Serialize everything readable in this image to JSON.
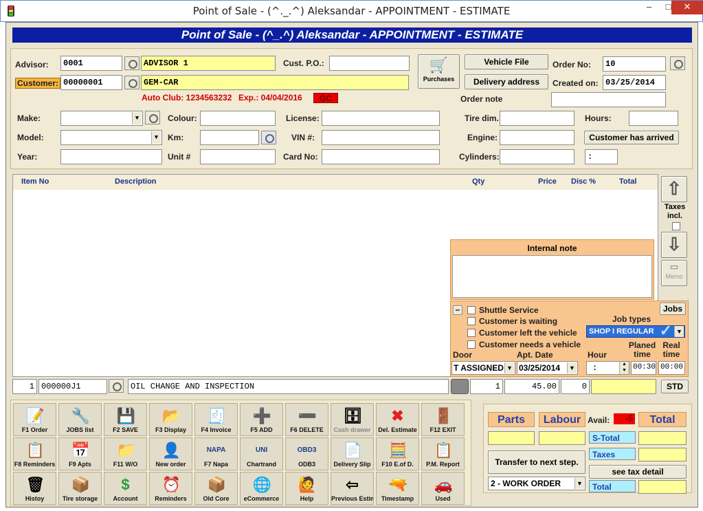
{
  "window": {
    "title": "Point of Sale - (^._.^) Aleksandar - APPOINTMENT - ESTIMATE",
    "minimize": "–",
    "maximize": "□",
    "close": "✕"
  },
  "banner": "Point of Sale - (^_.^) Aleksandar - APPOINTMENT - ESTIMATE",
  "header": {
    "advisor_label": "Advisor:",
    "advisor_code": "0001",
    "advisor_name": "ADVISOR 1",
    "customer_label": "Customer:",
    "customer_code": "00000001",
    "customer_name": "GEM-CAR",
    "auto_club": "Auto Club: 1234563232",
    "expiry": "Exp.: 04/04/2016",
    "gc_badge": "GC",
    "cust_po_label": "Cust. P.O.:",
    "cust_po": "",
    "purchases_label": "Purchases",
    "vehicle_file": "Vehicle File",
    "delivery_address": "Delivery address",
    "order_no_label": "Order No:",
    "order_no": "10",
    "created_label": "Created on:",
    "created_on": "03/25/2014",
    "order_note_label": "Order note",
    "order_note": ""
  },
  "vehicle": {
    "make_label": "Make:",
    "model_label": "Model:",
    "year_label": "Year:",
    "colour_label": "Colour:",
    "km_label": "Km:",
    "unit_label": "Unit #",
    "license_label": "License:",
    "vin_label": "VIN #:",
    "card_label": "Card No:",
    "tire_label": "Tire dim.",
    "engine_label": "Engine:",
    "cyl_label": "Cylinders:",
    "hours_label": "Hours:",
    "arrived_button": "Customer has arrived",
    "time_value": ":"
  },
  "grid": {
    "columns": [
      "Item No",
      "Description",
      "Qty",
      "Price",
      "Disc %",
      "Total"
    ],
    "taxes_incl": "Taxes incl.",
    "memo": "Memo"
  },
  "internal_note": {
    "title": "Internal note",
    "text": ""
  },
  "options": {
    "collapse": "–",
    "shuttle": "Shuttle Service",
    "waiting": "Customer is waiting",
    "left_vehicle": "Customer left the vehicle",
    "needs_vehicle": "Customer needs a vehicle",
    "jobs_button": "Jobs",
    "job_types_label": "Job types",
    "job_type_value": "SHOP I REGULAR",
    "door_label": "Door",
    "door_value": "T ASSIGNED",
    "apt_date_label": "Apt. Date",
    "apt_date_value": "03/25/2014",
    "hour_label": "Hour",
    "hour_value": ":",
    "planed_label": "Planed time",
    "planed_value": "00:30",
    "real_label": "Real time",
    "real_value": "00:00"
  },
  "entry_row": {
    "line": "1",
    "item": "000000J1",
    "description": "OIL CHANGE AND INSPECTION",
    "qty": "1",
    "price": "45.00",
    "disc": "0",
    "std": "STD"
  },
  "toolbar": [
    {
      "label": "F1 Order",
      "icon": "📝",
      "name": "f1-order-button"
    },
    {
      "label": "JOBS list",
      "icon": "🔧",
      "name": "jobs-list-button"
    },
    {
      "label": "F2 SAVE",
      "icon": "💾",
      "name": "f2-save-button"
    },
    {
      "label": "F3 Display",
      "icon": "📂",
      "name": "f3-display-button"
    },
    {
      "label": "F4 Invoice",
      "icon": "🧾",
      "name": "f4-invoice-button"
    },
    {
      "label": "F5 ADD",
      "icon": "➕",
      "name": "f5-add-button"
    },
    {
      "label": "F6 DELETE",
      "icon": "➖",
      "name": "f6-delete-button"
    },
    {
      "label": "Cash drawer",
      "icon": "🗄",
      "name": "cash-drawer-button",
      "dim": true
    },
    {
      "label": "Del. Estimate",
      "icon": "✖",
      "name": "del-estimate-button"
    },
    {
      "label": "F12 EXIT",
      "icon": "🚪",
      "name": "f12-exit-button"
    },
    {
      "label": "F8 Reminders",
      "icon": "📋",
      "name": "f8-reminders-button"
    },
    {
      "label": "F9 Apts",
      "icon": "📅",
      "name": "f9-apts-button"
    },
    {
      "label": "F11 W/O",
      "icon": "📁",
      "name": "f11-wo-button"
    },
    {
      "label": "New order",
      "icon": "👤",
      "name": "new-order-button"
    },
    {
      "label": "F7 Napa",
      "icon": "NAPA",
      "name": "f7-napa-button"
    },
    {
      "label": "Chartrand",
      "icon": "UNI",
      "name": "chartrand-button"
    },
    {
      "label": "ODB3",
      "icon": "OBD3",
      "name": "odb3-button"
    },
    {
      "label": "Delivery Slip",
      "icon": "📄",
      "name": "delivery-slip-button"
    },
    {
      "label": "F10 E.of D.",
      "icon": "🧮",
      "name": "f10-eod-button"
    },
    {
      "label": "P.M. Report",
      "icon": "📋",
      "name": "pm-report-button"
    },
    {
      "label": "Histoy",
      "icon": "🗑",
      "name": "history-button"
    },
    {
      "label": "Tire storage",
      "icon": "📦",
      "name": "tire-storage-button"
    },
    {
      "label": "Account",
      "icon": "$",
      "name": "account-button"
    },
    {
      "label": "Reminders",
      "icon": "⏰",
      "name": "reminders-button"
    },
    {
      "label": "Old Core",
      "icon": "📦",
      "name": "old-core-button"
    },
    {
      "label": "eCommerce",
      "icon": "🌐",
      "name": "ecommerce-button"
    },
    {
      "label": "Help",
      "icon": "🙋",
      "name": "help-button"
    },
    {
      "label": "Previous Estimate",
      "icon": "⇦",
      "name": "previous-estimate-button"
    },
    {
      "label": "Timestamp",
      "icon": "🔫",
      "name": "timestamp-button"
    },
    {
      "label": "Used",
      "icon": "🚗",
      "name": "used-button"
    }
  ],
  "summary": {
    "parts_label": "Parts",
    "labour_label": "Labour",
    "avail_label": "Avail:",
    "avail_value": "-5",
    "total_label": "Total",
    "stotal_label": "S-Total",
    "taxes_label": "Taxes",
    "total2_label": "Total",
    "transfer_button": "Transfer to next step.",
    "see_tax": "see tax detail",
    "step_value": "2 - WORK ORDER"
  }
}
